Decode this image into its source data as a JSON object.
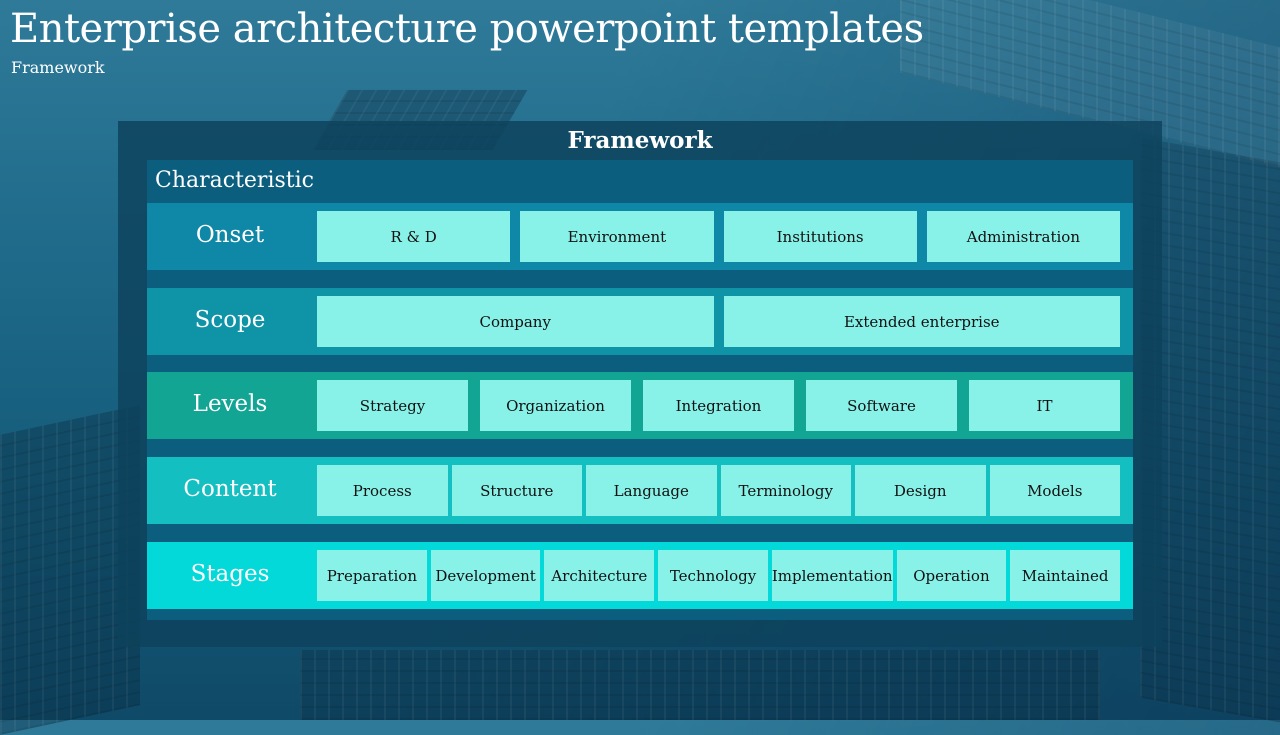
{
  "header": {
    "title": "Enterprise architecture powerpoint templates",
    "subtitle": "Framework"
  },
  "framework": {
    "title": "Framework",
    "characteristic_label": "Characteristic",
    "rows": [
      {
        "label": "Onset",
        "color": "#0e88a6",
        "items": [
          "R & D",
          "Environment",
          "Institutions",
          "Administration"
        ]
      },
      {
        "label": "Scope",
        "color": "#0f93a6",
        "items": [
          "Company",
          "Extended enterprise"
        ]
      },
      {
        "label": "Levels",
        "color": "#12a593",
        "items": [
          "Strategy",
          "Organization",
          "Integration",
          "Software",
          "IT"
        ]
      },
      {
        "label": "Content",
        "color": "#14bfc2",
        "items": [
          "Process",
          "Structure",
          "Language",
          "Terminology",
          "Design",
          "Models"
        ]
      },
      {
        "label": "Stages",
        "color": "#03d9d9",
        "items": [
          "Preparation",
          "Development",
          "Architecture",
          "Technology",
          "Implementation",
          "Operation",
          "Maintained"
        ]
      }
    ]
  },
  "colors": {
    "cell_fill": "#88f2e8",
    "inner_panel": "#0b5e7e",
    "outer_panel": "#0e425c"
  }
}
